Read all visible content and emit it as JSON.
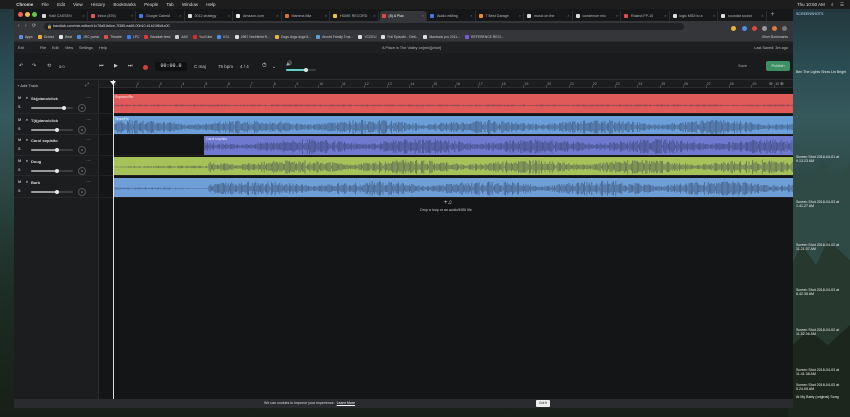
{
  "mac_menu": {
    "apple": "",
    "app_name": "Chrome",
    "items": [
      "File",
      "Edit",
      "View",
      "History",
      "Bookmarks",
      "People",
      "Tab",
      "Window",
      "Help"
    ],
    "clock": "Thu 10:50 AM",
    "search_glyph": "⌕",
    "control_glyph": "☰"
  },
  "tabs": [
    {
      "label": "Kalli CASSEN",
      "color": "#d8d8d8"
    },
    {
      "label": "Inbox (876)",
      "color": "#e35a4a"
    },
    {
      "label": "Google Calend",
      "color": "#3d7be8"
    },
    {
      "label": "2012 strategy",
      "color": "#dcdcdc"
    },
    {
      "label": "Amazon.com",
      "color": "#eeeeee"
    },
    {
      "label": "Mamma Mia",
      "color": "#e36c3a"
    },
    {
      "label": "HOME RECORD",
      "color": "#f3c23b"
    },
    {
      "label": "(8) A Plac",
      "color": "#e34a3a",
      "active": true
    },
    {
      "label": "Audio editing",
      "color": "#3d7be8"
    },
    {
      "label": "7 Best Garage",
      "color": "#f28b2e"
    },
    {
      "label": "music on the",
      "color": "#dddddd"
    },
    {
      "label": "condenser mic",
      "color": "#dddddd"
    },
    {
      "label": "Roland FP-10",
      "color": "#e34a4a"
    },
    {
      "label": "logic MIDI to a",
      "color": "#dddddd"
    },
    {
      "label": "soundat sound",
      "color": "#dddddd"
    }
  ],
  "address_bar": {
    "url": "bandlab.com/mix-editor/e1c78a51b6ce-7f385-ea65-00b10-b1b24f6d1c00",
    "nav": {
      "back": "‹",
      "forward": "›",
      "reload": "⟳",
      "home": "⌂",
      "lock": "🔒"
    }
  },
  "bookmarks": [
    {
      "label": "Apps",
      "color": "#5f8fd9"
    },
    {
      "label": "School",
      "color": "#f2a93b"
    },
    {
      "label": "Beat",
      "color": "#e3e3e3"
    },
    {
      "label": "JRC portal",
      "color": "#4a8ee6"
    },
    {
      "label": "Theatre",
      "color": "#e04e4e"
    },
    {
      "label": "LPC",
      "color": "#3d7be8"
    },
    {
      "label": "Bandlab feed",
      "color": "#e03a3a"
    },
    {
      "label": "AAV",
      "color": "#cccccc"
    },
    {
      "label": "YouTube",
      "color": "#e02a2a"
    },
    {
      "label": "KSL",
      "color": "#4a8ee6"
    },
    {
      "label": "4967 Northfield R...",
      "color": "#dddddd"
    },
    {
      "label": "Dogs dogs dogs 8...",
      "color": "#e8b33b"
    },
    {
      "label": "Arnold Family Trus...",
      "color": "#5aa0e0"
    },
    {
      "label": "YCCELI",
      "color": "#dddddd"
    },
    {
      "label": "Full Episode - Gett...",
      "color": "#dddddd"
    },
    {
      "label": "Macbook pro 2011...",
      "color": "#dddddd"
    },
    {
      "label": "REFERENCE RECI...",
      "color": "#7b5ae0"
    }
  ],
  "other_bookmarks": "Other Bookmarks",
  "app_menu": {
    "exit": "Exit",
    "items": [
      "File",
      "Edit",
      "View",
      "Settings",
      "Help"
    ],
    "project_title": "A Place in The Valley on[mix][choir]",
    "last_saved": "Last Saved: 3m ago"
  },
  "transport": {
    "undo": "↶",
    "redo": "↷",
    "loop": "⟲",
    "metronome_short": "0:0",
    "rewind": "⏮",
    "play": "▶",
    "forward": "⏭",
    "time": "00:00.0",
    "key": "C maj",
    "tempo": "75 bpm",
    "time_signature": "4 / 4",
    "metronome": "⏱",
    "metronome_dropdown": "⌄",
    "volume_icon": "🔊",
    "volume_level": 0.68,
    "save_label": "Save",
    "publish_label": "Publish"
  },
  "track_panel": {
    "add_track": "+ Add Track",
    "collapse": "⤢",
    "tracks": [
      {
        "name": "Sk(piano/click",
        "mute": "M",
        "solo": "S",
        "icon": "♦",
        "menu": "···",
        "pan": "⊙",
        "volume": 0.78,
        "lane_color": "#e05a5a",
        "region_label": "Soprano/Re",
        "region_start": 0.0
      },
      {
        "name": "T(t(piano/click",
        "mute": "M",
        "solo": "S",
        "icon": "♦",
        "menu": "···",
        "pan": "⊙",
        "volume": 0.62,
        "lane_color": "#6a9fd9",
        "region_label": "Tenor/Re",
        "region_start": 0.0
      },
      {
        "name": "Carol sop/alto",
        "mute": "M",
        "solo": "S",
        "icon": "♦",
        "menu": "···",
        "pan": "⊙",
        "volume": 0.62,
        "lane_color": "#6e79cf",
        "region_label": "Carol sop/alto",
        "region_start": 0.134
      },
      {
        "name": "Doug",
        "mute": "M",
        "solo": "S",
        "icon": "♦",
        "menu": "···",
        "pan": "⊙",
        "volume": 0.62,
        "lane_color": "#a8c25a",
        "region_label": "",
        "region_start": 0.0
      },
      {
        "name": "Barb",
        "mute": "M",
        "solo": "S",
        "icon": "♦",
        "menu": "···",
        "pan": "⊙",
        "volume": 0.62,
        "lane_color": "#6e9fd6",
        "region_label": "",
        "region_start": 0.0
      }
    ]
  },
  "ruler": {
    "marks": [
      "1",
      "2",
      "3",
      "4",
      "5",
      "6",
      "7",
      "8",
      "9",
      "10",
      "11",
      "12",
      "13",
      "14",
      "15",
      "16",
      "17",
      "18",
      "19",
      "20",
      "21",
      "22",
      "23",
      "24",
      "25",
      "26",
      "27",
      "28",
      "29",
      "30"
    ],
    "zoom_out": "⊖",
    "zoom_in": "⊕"
  },
  "drop_zone": {
    "icon": "+♫",
    "text": "Drop a loop or an audio/MIDI file"
  },
  "cookie": {
    "text": "We use cookies to improve your experience.",
    "link": "Learn More",
    "button": "Got it"
  },
  "desktop_screenshots": [
    {
      "label": "SCREENSHOTS"
    },
    {
      "label": "Ben The Lights Show Lin Bright"
    },
    {
      "label": "Screen Shot 2018-04-01 at 9.13.23 AM"
    },
    {
      "label": "Screen Shot 2018-04-03 at 1.41.27 AM"
    },
    {
      "label": "Screen Shot 2018-04-02 at 11.21.07 AM"
    },
    {
      "label": "Screen Shot 2018-04-03 at 8.42.35 AM"
    },
    {
      "label": "Screen Shot 2018-04-02 at 11.52.06 AM"
    },
    {
      "label": "Screen Shot 2018-04-03 at 11.41.38 AM"
    },
    {
      "label": "Screen Shot 2018-04-03 at 5.24.05 AM"
    },
    {
      "label": "At My Baby (original) Song"
    }
  ]
}
